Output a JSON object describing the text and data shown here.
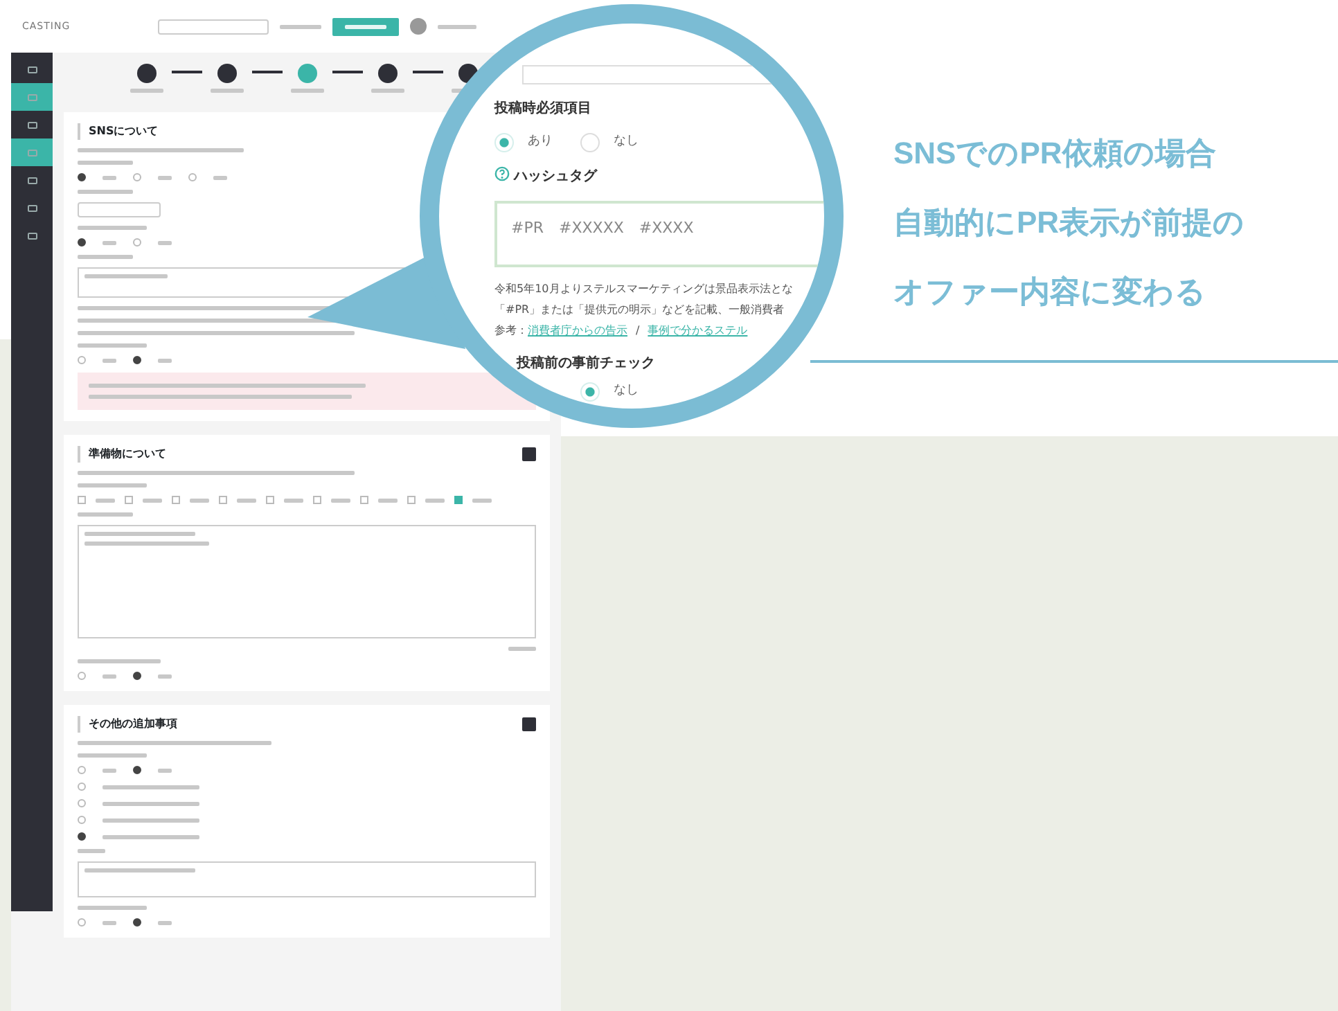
{
  "app": {
    "logo": "CASTING"
  },
  "sidebar": {
    "items": [
      {
        "selected": false
      },
      {
        "selected": true
      },
      {
        "selected": false
      },
      {
        "selected": true
      },
      {
        "selected": false
      },
      {
        "selected": false
      },
      {
        "selected": false
      }
    ]
  },
  "stepper": {
    "steps": [
      {
        "selected": false
      },
      {
        "selected": false
      },
      {
        "selected": true
      },
      {
        "selected": false
      },
      {
        "selected": false
      }
    ]
  },
  "sns_section": {
    "title": "SNSについて",
    "radio_groups": [
      [
        {
          "selected": true
        },
        {
          "selected": false
        },
        {
          "selected": false
        }
      ],
      [
        {
          "selected": true
        },
        {
          "selected": false
        }
      ],
      [
        {
          "selected": false
        },
        {
          "selected": true
        }
      ]
    ]
  },
  "supplies_section": {
    "title": "準備物について",
    "checkboxes": [
      {
        "checked": false
      },
      {
        "checked": false
      },
      {
        "checked": false
      },
      {
        "checked": false
      },
      {
        "checked": false
      },
      {
        "checked": false
      },
      {
        "checked": false
      },
      {
        "checked": false
      },
      {
        "checked": true
      }
    ],
    "radio_group": [
      {
        "selected": false
      },
      {
        "selected": true
      }
    ]
  },
  "extras_section": {
    "title": "その他の追加事項",
    "radio_group": [
      {
        "selected": false
      },
      {
        "selected": true
      }
    ],
    "options": [
      {
        "selected": false
      },
      {
        "selected": false
      },
      {
        "selected": false
      },
      {
        "selected": true
      }
    ],
    "radio_group_2": [
      {
        "selected": false
      },
      {
        "selected": true
      }
    ]
  },
  "magnifier": {
    "required_label": "投稿時必須項目",
    "required_options": [
      {
        "label": "あり",
        "selected": true
      },
      {
        "label": "なし",
        "selected": false
      }
    ],
    "hashtag_label": "ハッシュタグ",
    "hashtag_value": "#PR　#XXXXX　#XXXX",
    "notice_lines": [
      "令和5年10月よりステルスマーケティングは景品表示法とな",
      "「#PR」または「提供元の明示」などを記載、一般消費者"
    ],
    "reference_label": "参考：",
    "reference_links": [
      "消費者庁からの告示",
      "事例で分かるステル"
    ],
    "link_separator": "/",
    "precheck_label": "投稿前の事前チェック",
    "precheck_options": [
      {
        "label": "なし",
        "selected": true
      }
    ]
  },
  "callout": {
    "lines": [
      "SNSでのPR依頼の場合",
      "自動的にPR表示が前提の",
      "オファー内容に変わる"
    ]
  }
}
